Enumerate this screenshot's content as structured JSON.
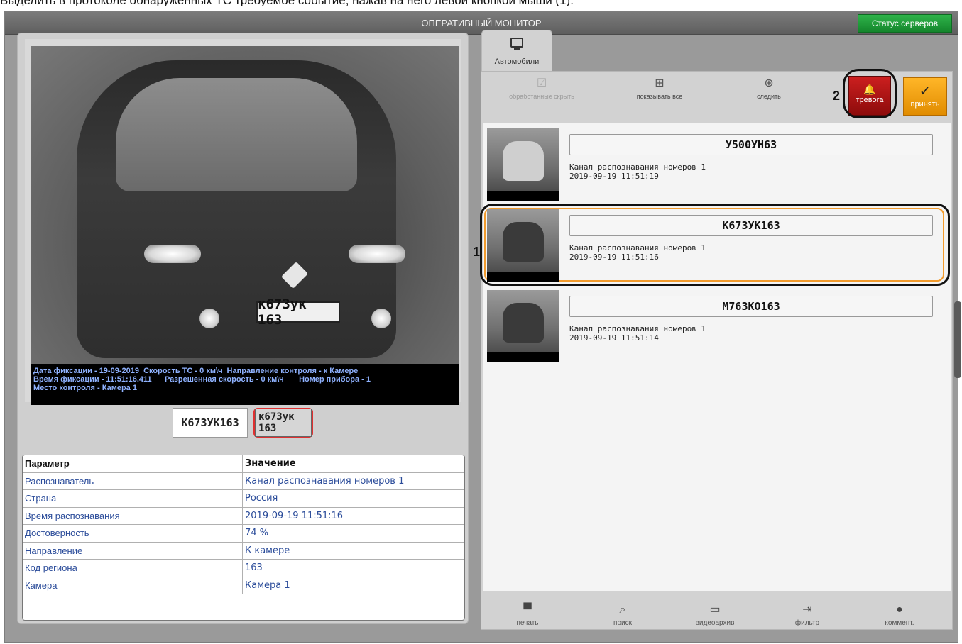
{
  "caption": "Выделить в протоколе обнаруженных ТС требуемое событие, нажав на него левой кнопкой мыши (1).",
  "window": {
    "title": "ОПЕРАТИВНЫЙ МОНИТОР",
    "server_status_label": "Статус серверов"
  },
  "photo": {
    "plate_on_car": "к673ук 163",
    "overlay_line1": "Дата фиксации - 19-09-2019  Скорость ТС - 0 км\\ч  Направление контроля - к Камере",
    "overlay_line2": "Время фиксации - 11:51:16.411      Разрешенная скорость - 0 км\\ч       Номер прибора - 1",
    "overlay_line3": "Место контроля - Камера 1"
  },
  "plate_recognized": "К673УК163",
  "plate_image_text": "к673ук 163",
  "params": {
    "header": {
      "param": "Параметр",
      "value": "Значение"
    },
    "rows": [
      {
        "param": "Распознаватель",
        "value": "Канал распознавания номеров 1"
      },
      {
        "param": "Страна",
        "value": "Россия"
      },
      {
        "param": "Время распознавания",
        "value": "2019-09-19 11:51:16"
      },
      {
        "param": "Достоверность",
        "value": "74 %"
      },
      {
        "param": "Направление",
        "value": "К камере"
      },
      {
        "param": "Код региона",
        "value": "163"
      },
      {
        "param": "Камера",
        "value": "Камера 1"
      }
    ]
  },
  "tab": {
    "label": "Автомобили",
    "icon": "monitor-icon"
  },
  "toolbar": {
    "hide_processed": "обработанные скрыть",
    "show_all": "показывать все",
    "follow": "следить",
    "alarm": "тревога",
    "accept": "принять",
    "marker_2": "2"
  },
  "events": [
    {
      "plate": "У500УН63",
      "channel": "Канал распознавания номеров 1",
      "time": "2019-09-19 11:51:19"
    },
    {
      "plate": "К673УК163",
      "channel": "Канал распознавания номеров 1",
      "time": "2019-09-19 11:51:16"
    },
    {
      "plate": "М763КО163",
      "channel": "Канал распознавания номеров 1",
      "time": "2019-09-19 11:51:14"
    }
  ],
  "marker_1": "1",
  "bottom": {
    "print": "печать",
    "search": "поиск",
    "video_archive": "видеоархив",
    "filter": "фильтр",
    "comment": "коммент."
  },
  "colors": {
    "server_status_bg": "#14862c",
    "alarm_bg": "#b11616",
    "accept_bg": "#f0a010",
    "selection_border": "#f29b2d"
  }
}
